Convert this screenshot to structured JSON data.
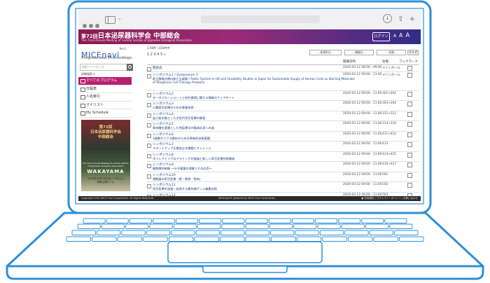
{
  "browser": {
    "chevron": "⌄",
    "download": "↓",
    "share": "⇪",
    "new_tab": "+"
  },
  "header": {
    "title_num": "第72回",
    "title_main": "日本泌尿器科学会 中部総会",
    "subtitle": "The 72nd Annual Meeting of Central Section of Japanese Urological Association",
    "login_label": "ログイン",
    "font_sizes": [
      "A",
      "A",
      "A"
    ]
  },
  "logo": {
    "name": "MICEnavi",
    "version": "Ver3",
    "tagline": "Program and Proceedings"
  },
  "search": {
    "placeholder": "検索ワードを入力",
    "advanced": "詳細検索 ▾"
  },
  "nav": [
    {
      "label": "すべてのプログラム",
      "active": true
    },
    {
      "label": "日程表",
      "active": false
    },
    {
      "label": "人名索引",
      "active": false
    },
    {
      "label": "マイリスト",
      "active": false
    },
    {
      "label": "My Schedule",
      "active": false
    }
  ],
  "poster": {
    "line1": "第72回",
    "line2": "日本泌尿器科学会",
    "line3": "中部総会",
    "english": "The 72nd Annual Meeting of Central Section of Japanese Urological Association",
    "city": "WAKAYAMA",
    "date": "2022年10月20日(木)~22日(土)",
    "venue": "和歌山城ホール"
  },
  "main": {
    "date_filter": "1-50件 / 210件中",
    "pagination": "1 2 3 4 5 »",
    "filters": [
      "-- 発表形式 --",
      "-- 開催日 --",
      "-- 会場 --"
    ],
    "clear_label": "クリア",
    "columns": {
      "date": "開催日時",
      "room": "会場",
      "bookmark": "ブックマーク"
    },
    "rows": [
      {
        "code": "開会式",
        "title": "",
        "datetime": "2020-03-12 08:50 - 09:00",
        "room": "メインホール"
      },
      {
        "code": "シンポジウム1 / Symposium 1",
        "title": "前立腺癌治療の新たな展開 / Public System in UK and Feasibility Studies in Japan for Sustainable Supply of Human Cells as Starting Materials of Allogeneic Cell Therapy Products",
        "datetime": "2020-03-12 09:00 - 11:00",
        "room": "メインホール"
      },
      {
        "code": "シンポジウム2",
        "title": "データマネージメントと研究倫理に関する情報のアップデート",
        "datetime": "2020-03-12 09:00 - 11:00",
        "room": "301+302"
      },
      {
        "code": "シンポジウム3",
        "title": "心臓再生医療のための基盤技術",
        "datetime": "2020-03-12 09:00 - 11:00",
        "room": "303+304"
      },
      {
        "code": "シンポジウム4",
        "title": "血小板を軸とした次世代再生医療の開発",
        "datetime": "2020-03-12 09:00 - 11:00",
        "room": "311+312"
      },
      {
        "code": "シンポジウム5",
        "title": "骨肉腫を基盤とした免疫療法の臨床応用への道",
        "datetime": "2020-03-12 09:00 - 11:00",
        "room": "313+314"
      },
      {
        "code": "シンポジウム6",
        "title": "1細胞オミクス解析のための革新的技術基盤",
        "datetime": "2020-03-12 09:00 - 11:00",
        "room": "411+412"
      },
      {
        "code": "シンポジウム7",
        "title": "スタートアップ企業設立の課題とチャレンジ",
        "datetime": "2020-03-12 09:00 - 11:00",
        "room": "413"
      },
      {
        "code": "シンポジウム8",
        "title": "ダイレクトリプログラミングの進展と新しい再生医療技術開発",
        "datetime": "2020-03-12 09:00 - 11:00",
        "room": "414+415"
      },
      {
        "code": "シンポジウム9",
        "title": "細胞運命制御 〜分子基盤の理解とその応用〜",
        "datetime": "2020-03-12 09:00 - 11:00",
        "room": "416+417"
      },
      {
        "code": "シンポジウム10",
        "title": "運動器の再生医療（骨・軟骨・筋肉）",
        "datetime": "2020-03-12 09:00 - 11:00",
        "room": "501"
      },
      {
        "code": "シンポジウム11",
        "title": "再生医療を加速・拡張する最先端ゲノム編集技術",
        "datetime": "2020-03-12 09:00 - 11:00",
        "room": "502"
      },
      {
        "code": "シンポジウム12",
        "title": "iPS細胞を用いた再生医療の現状と今後の展望",
        "datetime": "2020-03-12 09:00 - 11:00",
        "room": "503"
      }
    ]
  },
  "footer": {
    "copyright": "Copyright 2022 MICE One Corporation. All Rights Reserved.",
    "powered": "MICEnavi® powered by MICE One Corporation",
    "links": "● 利用規約 | プライバシーポリシー | お問い合わせ"
  }
}
